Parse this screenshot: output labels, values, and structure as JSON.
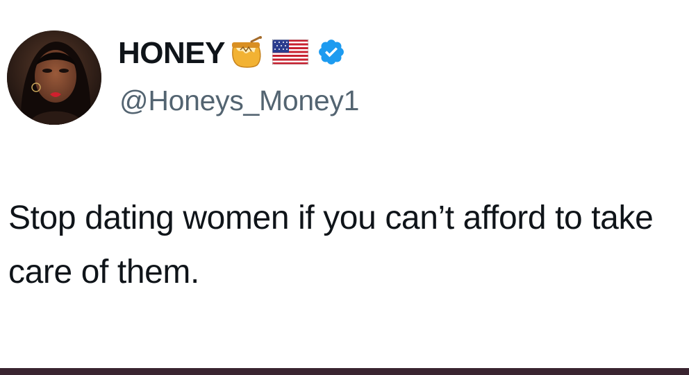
{
  "tweet": {
    "display_name": "HONEY",
    "handle": "@Honeys_Money1",
    "text": "Stop dating women if you can’t afford to take care of them.",
    "badges": [
      "honey-pot-emoji",
      "us-flag-emoji",
      "verified-badge"
    ]
  },
  "colors": {
    "text": "#0f1419",
    "handle": "#536471",
    "verified": "#1d9bf0",
    "bottom_bar": "#3a2430"
  }
}
